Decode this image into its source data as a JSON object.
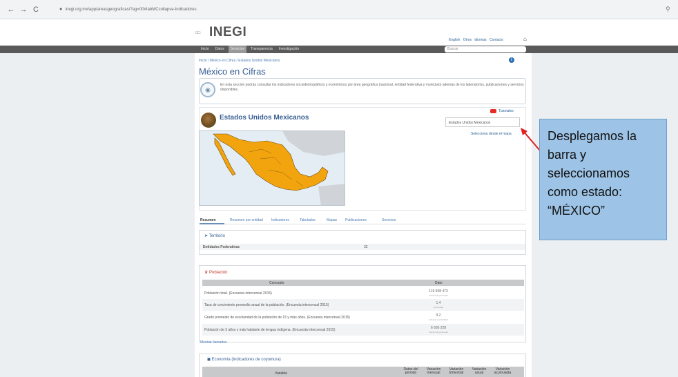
{
  "browser": {
    "back_icon": "←",
    "forward_icon": "→",
    "reload_icon": "C",
    "address_url": "inegi.org.mx/app/areasgeograficas/?ag=00#tabMCcollapse-Indicadores"
  },
  "header": {
    "logo_small": "INEGI",
    "logo": "INEGI",
    "top_links": "English  Otros idiomas  Contacto",
    "nav": [
      "Inicio",
      "Datos",
      "Servicios",
      "Transparencia",
      "Investigación"
    ],
    "active_nav": "Servicios",
    "search_placeholder": "Buscar"
  },
  "main": {
    "breadcrumb": "Inicio / México en Cifras / Estados Unidos Mexicanos",
    "title": "México en Cifras",
    "intro": "En esta sección podrás consultar los indicadores sociodemográficos y económicos por área geográfica (nacional, entidad federativa y municipio) además de los laboratorios, publicaciones y servicios disponibles.",
    "tutoriales": "Tutoriales",
    "entity_title": "Estados Unidos Mexicanos",
    "state_select_value": "Estados Unidos Mexicanos",
    "map_link": "Selecciona desde el mapa",
    "tabs": [
      "Resumen",
      "Resumen por entidad",
      "Indicadores",
      "Tabulados",
      "Mapas",
      "Publicaciones",
      "Servicios"
    ],
    "territorio": {
      "heading": "Territorio",
      "label": "Entidades Federativas",
      "value": "32"
    },
    "poblacion": {
      "heading": "Población",
      "col_concept": "Concepto",
      "col_data": "Dato",
      "rows": [
        {
          "concept": "Población total. (Encuesta intercensal 2015)",
          "value": "119 938 473",
          "unit": "número de personas"
        },
        {
          "concept": "Tasa de crecimiento promedio anual de la población. (Encuesta intercensal 2015)",
          "value": "1.4",
          "unit": "porcentaje"
        },
        {
          "concept": "Grado promedio de escolaridad de la población de 15 y más años. (Encuesta intercensal 2015)",
          "value": "9.2",
          "unit": "años de escolaridad"
        },
        {
          "concept": "Población de 3 años y más hablante de lengua indígena. (Encuesta intercensal 2015)",
          "value": "6 695 228",
          "unit": "número de personas"
        }
      ],
      "more_link": "Mostrar llamados"
    },
    "economia": {
      "heading": "Economía (Indicadores de coyuntura)",
      "col_variable": "Variable",
      "cols": [
        "Datos del periodo",
        "Variación mensual",
        "Variación trimestral",
        "Variación anual",
        "Variación acumulada"
      ]
    }
  },
  "callout": {
    "lines": [
      "Desplegamos la",
      "barra y",
      "seleccionamos",
      "como estado:",
      "“MÉXICO”"
    ]
  },
  "colors": {
    "navbar": "#5a5a5a",
    "title_blue": "#3a5f95",
    "callout_fill": "#9dc3e6",
    "arrow": "#e02020",
    "mexico_fill": "#f2a40f"
  }
}
